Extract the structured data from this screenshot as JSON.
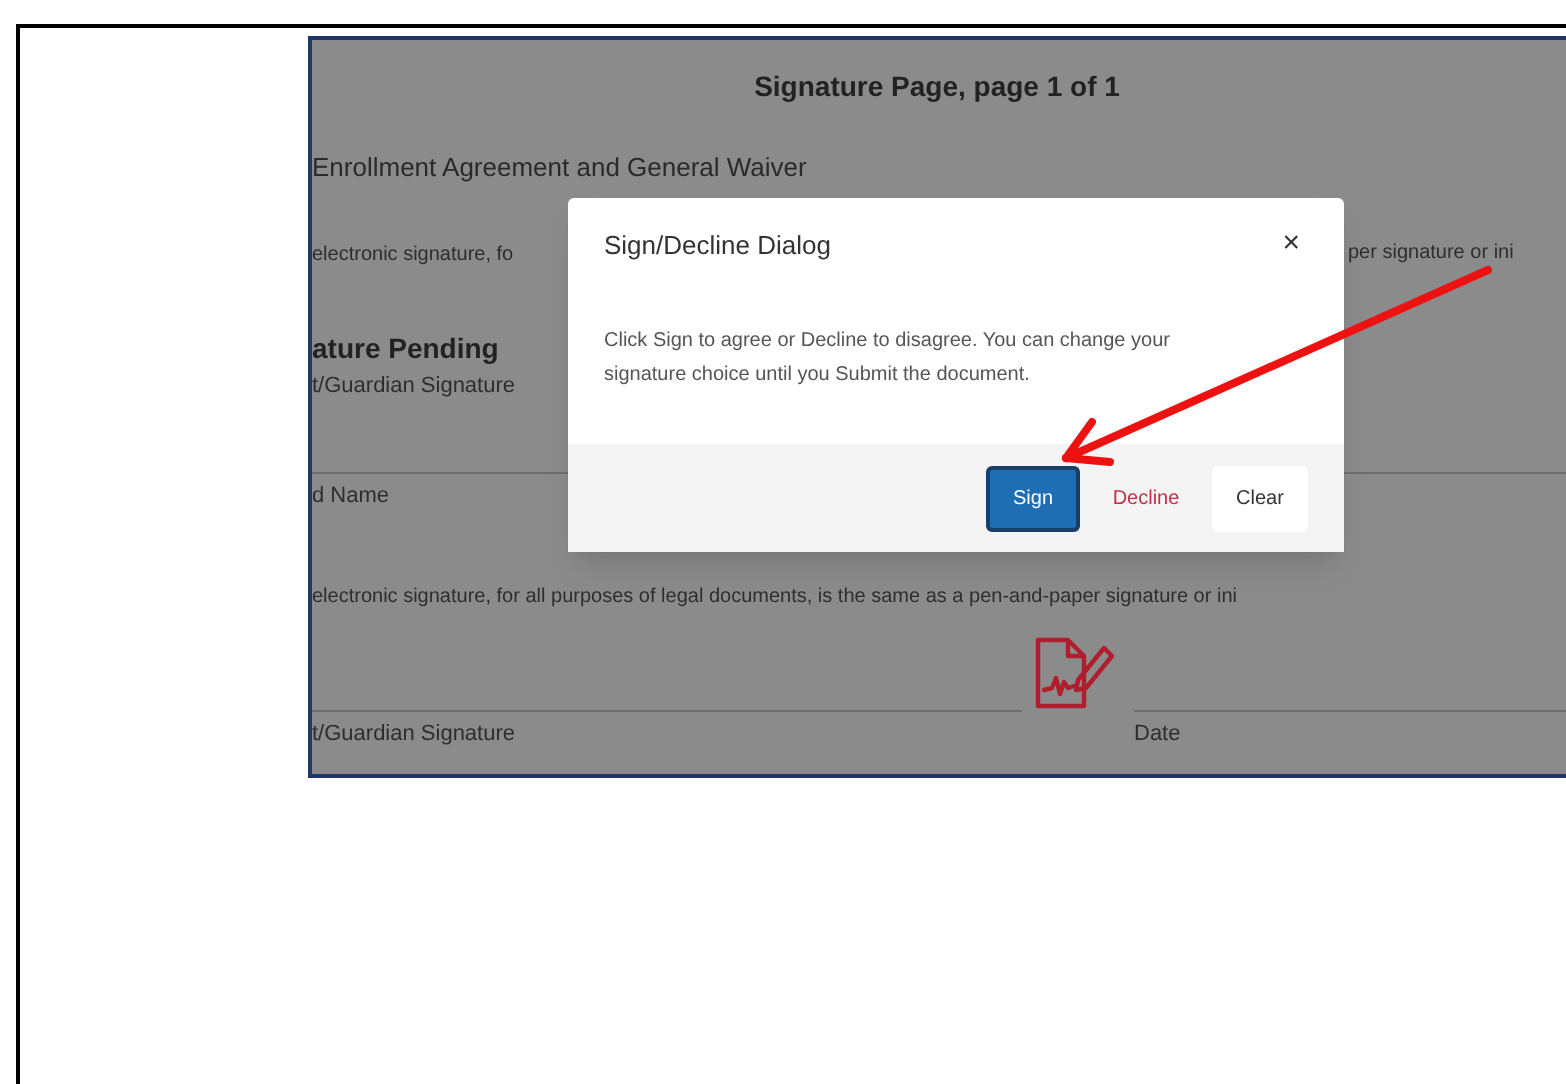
{
  "document": {
    "title": "Signature Page, page 1 of 1",
    "agreement_title": "Enrollment Agreement and General Waiver",
    "consent_left": "electronic signature, fo",
    "consent_right": "per signature or ini",
    "section_heading": "ature Pending",
    "signature_label": "t/Guardian Signature",
    "name_label": "d Name",
    "consent_line": "electronic signature, for all purposes of legal documents, is the same as a pen-and-paper signature or ini",
    "signature_line_label": "t/Guardian Signature",
    "date_label": "Date"
  },
  "dialog": {
    "title": "Sign/Decline Dialog",
    "close": "×",
    "message": "Click Sign to agree or Decline to disagree. You can change your signature choice until you Submit the document.",
    "buttons": [
      {
        "label": "Sign",
        "kind": "primary"
      },
      {
        "label": "Decline",
        "kind": "danger"
      },
      {
        "label": "Clear",
        "kind": "default"
      }
    ]
  }
}
